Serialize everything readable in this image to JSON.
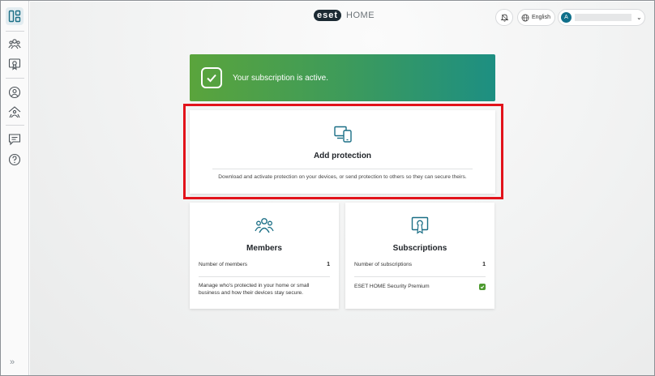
{
  "header": {
    "logo_mark": "eset",
    "logo_text": "HOME",
    "language_label": "English",
    "account_initial": "A"
  },
  "sidebar": {
    "items": [
      {
        "icon": "dashboard-icon"
      },
      {
        "icon": "members-icon"
      },
      {
        "icon": "subscription-icon"
      },
      {
        "icon": "account-icon"
      },
      {
        "icon": "connected-home-icon"
      },
      {
        "icon": "feedback-icon"
      },
      {
        "icon": "help-icon"
      }
    ],
    "expand_label": "»"
  },
  "banner": {
    "text": "Your subscription is active.",
    "color_start": "#5aa43c",
    "color_end": "#1d8f82"
  },
  "add_protection": {
    "title": "Add protection",
    "description": "Download and activate protection on your devices, or send protection to others so they can secure theirs.",
    "icon": "devices-icon",
    "highlight_color": "#e2131b"
  },
  "members": {
    "title": "Members",
    "icon": "members-icon",
    "count_label": "Number of members",
    "count_value": "1",
    "description": "Manage who's protected in your home or small business and how their devices stay secure."
  },
  "subscriptions": {
    "title": "Subscriptions",
    "icon": "certificate-icon",
    "count_label": "Number of subscriptions",
    "count_value": "1",
    "item_label": "ESET HOME Security Premium",
    "item_status_icon": "checkmark-icon",
    "status_color": "#4d9a2f"
  },
  "colors": {
    "accent": "#0f6f8a",
    "icon_teal": "#1b6f86"
  }
}
